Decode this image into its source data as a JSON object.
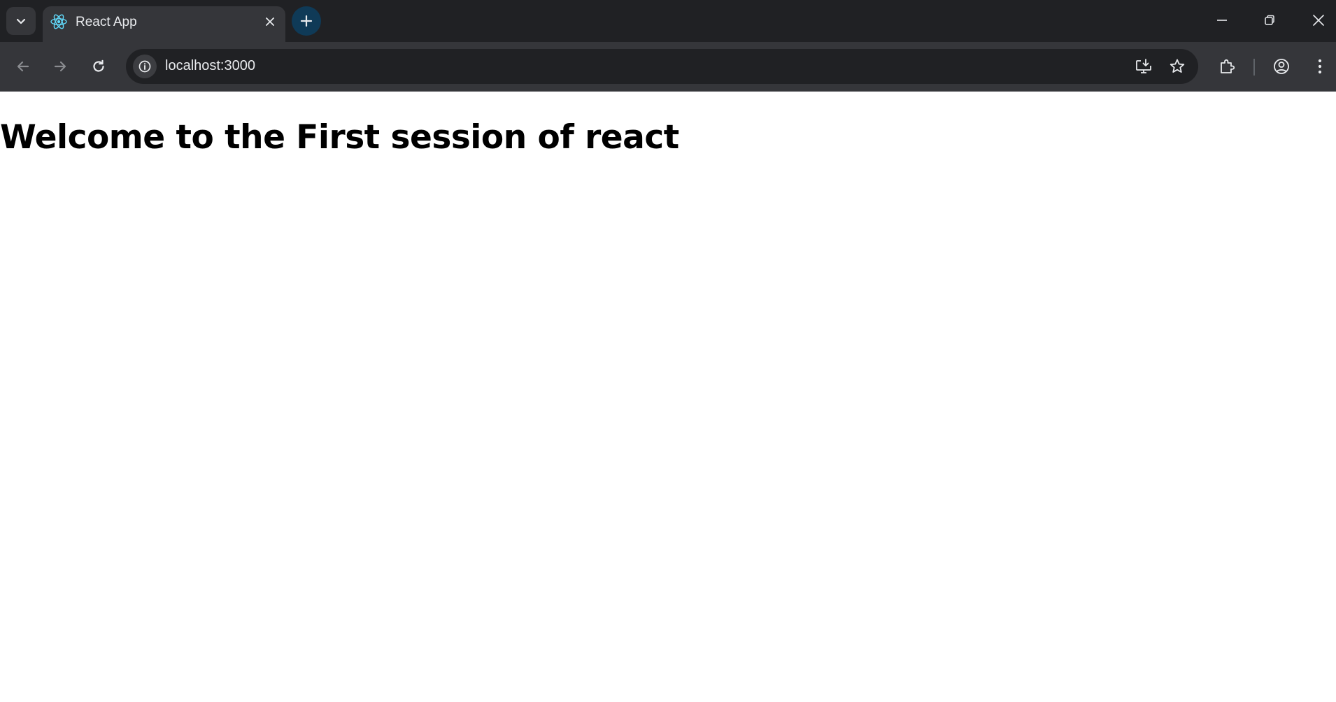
{
  "browser": {
    "tab": {
      "title": "React App",
      "favicon": "react-logo-icon"
    },
    "address_bar": {
      "url": "localhost:3000"
    },
    "colors": {
      "tabstrip_bg": "#202124",
      "toolbar_bg": "#35363a",
      "new_tab_bg": "#0f3a57",
      "react_blue": "#61dafb"
    },
    "icons": {
      "tab_search": "chevron-down-icon",
      "tab_close": "close-icon",
      "new_tab": "plus-icon",
      "minimize": "minimize-icon",
      "restore": "restore-icon",
      "close_window": "close-icon",
      "back": "arrow-left-icon",
      "forward": "arrow-right-icon",
      "reload": "reload-icon",
      "site_info": "info-icon",
      "install_app": "install-app-icon",
      "bookmark": "star-icon",
      "extensions": "puzzle-icon",
      "profile": "profile-icon",
      "menu": "kebab-menu-icon"
    }
  },
  "page": {
    "heading": "Welcome to the First session of react"
  }
}
